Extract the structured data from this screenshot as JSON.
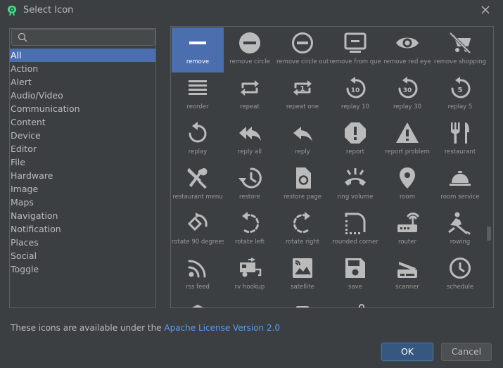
{
  "window": {
    "title": "Select Icon",
    "accent": "#4b6eaf",
    "link_color": "#589df6"
  },
  "search": {
    "value": "",
    "placeholder": ""
  },
  "categories": [
    "All",
    "Action",
    "Alert",
    "Audio/Video",
    "Communication",
    "Content",
    "Device",
    "Editor",
    "File",
    "Hardware",
    "Image",
    "Maps",
    "Navigation",
    "Notification",
    "Places",
    "Social",
    "Toggle"
  ],
  "selected_category": "All",
  "icons": [
    {
      "name": "remove",
      "icon": "remove-icon",
      "selected": true
    },
    {
      "name": "remove circle",
      "icon": "remove-circle-icon"
    },
    {
      "name": "remove circle outl",
      "icon": "remove-circle-outline-icon"
    },
    {
      "name": "remove from que",
      "icon": "remove-from-queue-icon"
    },
    {
      "name": "remove red eye",
      "icon": "eye-icon"
    },
    {
      "name": "remove shopping",
      "icon": "remove-shopping-cart-icon"
    },
    {
      "name": "reorder",
      "icon": "reorder-icon"
    },
    {
      "name": "repeat",
      "icon": "repeat-icon"
    },
    {
      "name": "repeat one",
      "icon": "repeat-one-icon"
    },
    {
      "name": "replay 10",
      "icon": "replay-10-icon"
    },
    {
      "name": "replay 30",
      "icon": "replay-30-icon"
    },
    {
      "name": "replay 5",
      "icon": "replay-5-icon"
    },
    {
      "name": "replay",
      "icon": "replay-icon"
    },
    {
      "name": "reply all",
      "icon": "reply-all-icon"
    },
    {
      "name": "reply",
      "icon": "reply-icon"
    },
    {
      "name": "report",
      "icon": "report-icon"
    },
    {
      "name": "report problem",
      "icon": "warning-icon"
    },
    {
      "name": "restaurant",
      "icon": "restaurant-icon"
    },
    {
      "name": "restaurant menu",
      "icon": "restaurant-menu-icon"
    },
    {
      "name": "restore",
      "icon": "restore-icon"
    },
    {
      "name": "restore page",
      "icon": "restore-page-icon"
    },
    {
      "name": "ring volume",
      "icon": "ring-volume-icon"
    },
    {
      "name": "room",
      "icon": "room-pin-icon"
    },
    {
      "name": "room service",
      "icon": "room-service-icon"
    },
    {
      "name": "rotate 90 degrees",
      "icon": "rotate-90-icon"
    },
    {
      "name": "rotate left",
      "icon": "rotate-left-icon"
    },
    {
      "name": "rotate right",
      "icon": "rotate-right-icon"
    },
    {
      "name": "rounded corner",
      "icon": "rounded-corner-icon"
    },
    {
      "name": "router",
      "icon": "router-icon"
    },
    {
      "name": "rowing",
      "icon": "rowing-icon"
    },
    {
      "name": "rss feed",
      "icon": "rss-feed-icon"
    },
    {
      "name": "rv hookup",
      "icon": "rv-hookup-icon"
    },
    {
      "name": "satellite",
      "icon": "satellite-icon"
    },
    {
      "name": "save",
      "icon": "save-icon"
    },
    {
      "name": "scanner",
      "icon": "scanner-icon"
    },
    {
      "name": "schedule",
      "icon": "schedule-icon"
    },
    {
      "name": "",
      "icon": "school-icon"
    },
    {
      "name": "",
      "icon": "screen-icon"
    },
    {
      "name": "",
      "icon": "screen-lock-icon"
    },
    {
      "name": "",
      "icon": "screen-lock-rotation-icon"
    },
    {
      "name": "",
      "icon": "screen-rotation-icon"
    },
    {
      "name": "",
      "icon": "screen-share-icon"
    }
  ],
  "footer": {
    "license_prefix": "These icons are available under the ",
    "license_link": "Apache License Version 2.0",
    "ok_label": "OK",
    "cancel_label": "Cancel"
  }
}
